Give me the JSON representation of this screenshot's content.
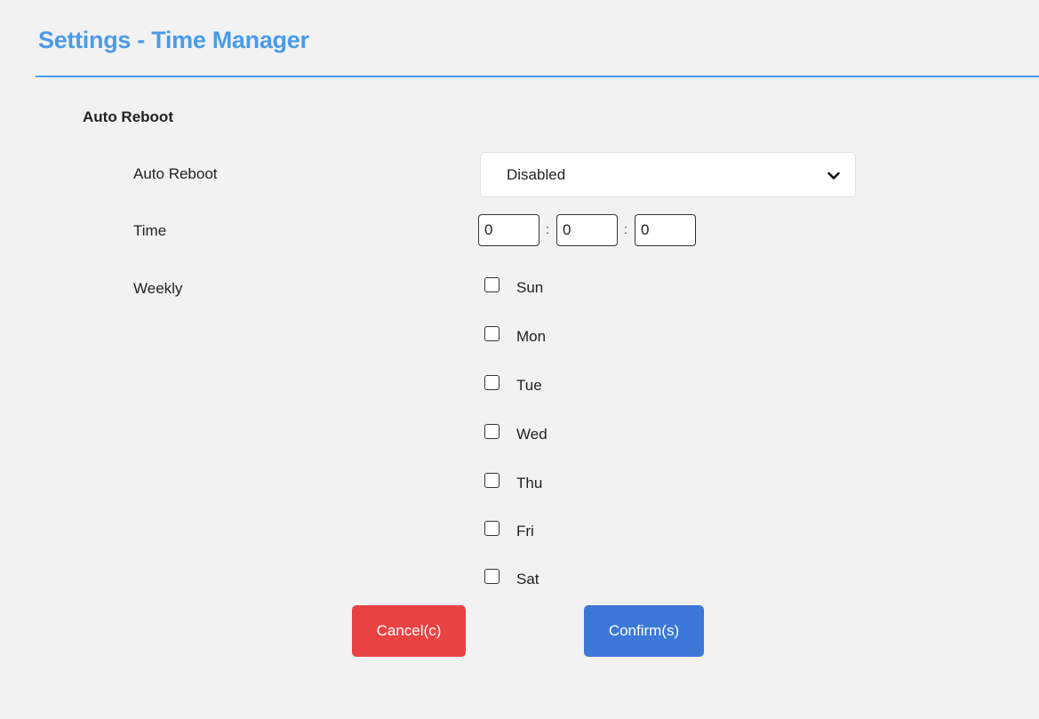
{
  "header": {
    "title": "Settings - Time Manager"
  },
  "section": {
    "title": "Auto Reboot"
  },
  "auto_reboot": {
    "label": "Auto Reboot",
    "selected": "Disabled"
  },
  "time": {
    "label": "Time",
    "hours": "0",
    "minutes": "0",
    "seconds": "0",
    "separator": ":"
  },
  "weekly": {
    "label": "Weekly",
    "days": [
      {
        "label": "Sun",
        "checked": false
      },
      {
        "label": "Mon",
        "checked": false
      },
      {
        "label": "Tue",
        "checked": false
      },
      {
        "label": "Wed",
        "checked": false
      },
      {
        "label": "Thu",
        "checked": false
      },
      {
        "label": "Fri",
        "checked": false
      },
      {
        "label": "Sat",
        "checked": false
      }
    ]
  },
  "buttons": {
    "cancel": "Cancel(c)",
    "confirm": "Confirm(s)"
  },
  "colors": {
    "accent": "#4a9bea",
    "cancel": "#e84342",
    "confirm": "#3b78d8",
    "background": "#f2f2f2"
  },
  "icons": {
    "dropdown": "chevron-down-icon"
  }
}
